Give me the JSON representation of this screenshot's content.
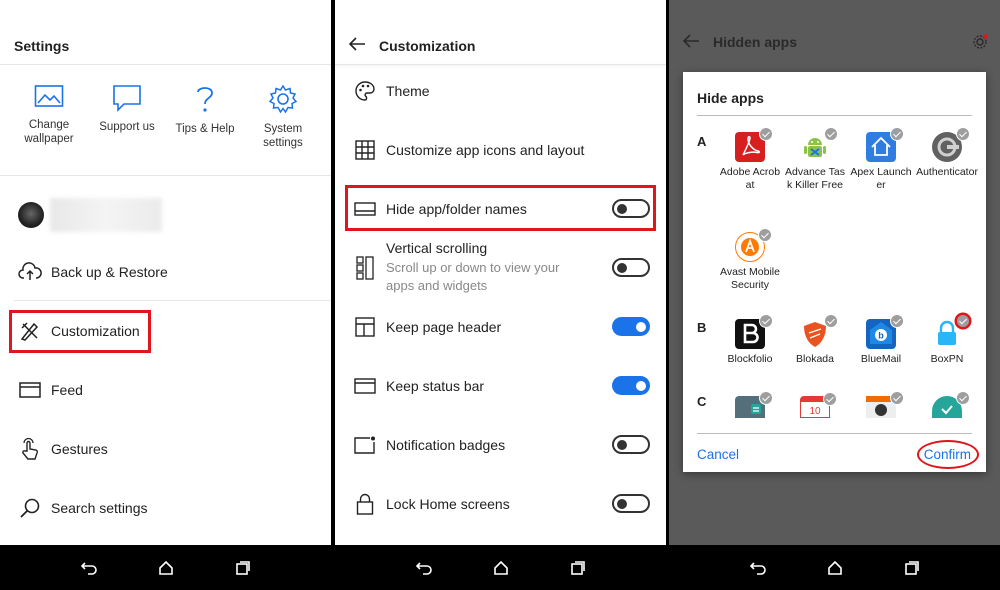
{
  "panel1": {
    "title": "Settings",
    "quick_actions": [
      {
        "icon": "image-icon",
        "label": "Change wallpaper"
      },
      {
        "icon": "chat-bubble-icon",
        "label": "Support us"
      },
      {
        "icon": "question-mark-icon",
        "label": "Tips & Help"
      },
      {
        "icon": "gear-icon",
        "label": "System settings"
      }
    ],
    "items": [
      {
        "icon": "cloud-upload-icon",
        "label": "Back up & Restore"
      },
      {
        "icon": "brush-pencil-icon",
        "label": "Customization"
      },
      {
        "icon": "feed-icon",
        "label": "Feed"
      },
      {
        "icon": "gesture-hand-icon",
        "label": "Gestures"
      },
      {
        "icon": "search-icon",
        "label": "Search settings"
      }
    ]
  },
  "panel2": {
    "title": "Customization",
    "items": [
      {
        "icon": "palette-icon",
        "label": "Theme"
      },
      {
        "icon": "grid-icon",
        "label": "Customize app icons and layout"
      },
      {
        "icon": "label-bar-icon",
        "label": "Hide app/folder names",
        "toggle": "off"
      },
      {
        "icon": "vertical-scroll-icon",
        "label": "Vertical scrolling",
        "sub": "Scroll up or down to view your apps and widgets",
        "toggle": "off"
      },
      {
        "icon": "page-header-icon",
        "label": "Keep page header",
        "toggle": "on"
      },
      {
        "icon": "status-bar-icon",
        "label": "Keep status bar",
        "toggle": "on"
      },
      {
        "icon": "notification-badge-icon",
        "label": "Notification badges",
        "toggle": "off"
      },
      {
        "icon": "lock-icon",
        "label": "Lock Home screens",
        "toggle": "off"
      }
    ]
  },
  "panel3": {
    "title": "Hidden apps",
    "dialog": {
      "title": "Hide apps",
      "sections": [
        {
          "letter": "A",
          "apps": [
            "Adobe Acrobat",
            "Advance Task Killer Free",
            "Apex Launcher",
            "Authenticator",
            "Avast Mobile Security"
          ]
        },
        {
          "letter": "B",
          "apps": [
            "Blockfolio",
            "Blokada",
            "BlueMail",
            "BoxPN"
          ]
        },
        {
          "letter": "C",
          "apps": [
            "",
            "",
            "",
            ""
          ]
        }
      ],
      "cancel": "Cancel",
      "confirm": "Confirm"
    }
  },
  "colors": {
    "accent": "#1a73e8",
    "highlight": "#e0161c",
    "adobe": "#d71f1f",
    "android": "#8bc34a",
    "apex": "#2f7de1"
  }
}
